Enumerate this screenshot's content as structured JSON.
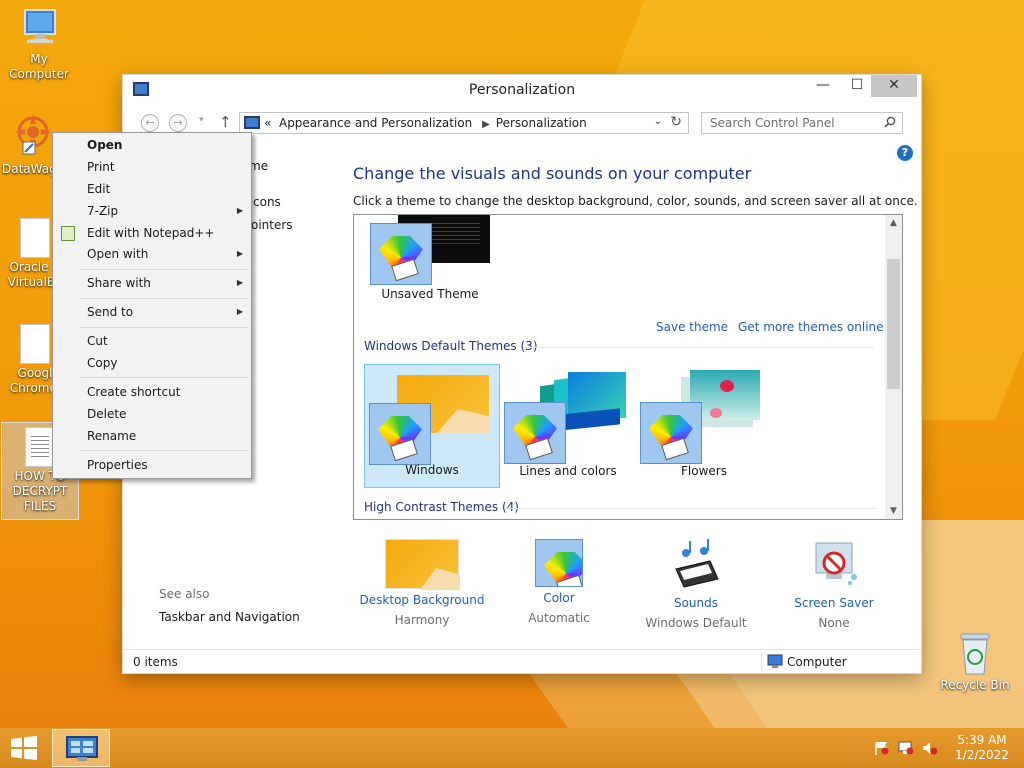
{
  "desktop": {
    "icons": [
      {
        "label": "My Computer"
      },
      {
        "label": "DataWag"
      },
      {
        "label_line1": "Oracle V",
        "label_line2": "VirtualBo"
      },
      {
        "label_line1": "Googl",
        "label_line2": "Chromel"
      },
      {
        "label_line1": "HOW TO",
        "label_line2": "DECRYPT",
        "label_line3": "FILES"
      },
      {
        "label": "Recycle Bin"
      }
    ]
  },
  "window": {
    "title": "Personalization",
    "controls": {
      "minimize": "—",
      "maximize": "☐",
      "close": "✕"
    },
    "address": {
      "prefix": "«",
      "crumbs": [
        "Appearance and Personalization",
        "Personalization"
      ]
    },
    "search": {
      "placeholder": "Search Control Panel"
    },
    "left_pane": {
      "links": [
        "me",
        "cons",
        "ointers"
      ],
      "see_also": "See also",
      "see_also_links": [
        "Taskbar and Navigation"
      ]
    },
    "heading": "Change the visuals and sounds on your computer",
    "subtext": "Click a theme to change the desktop background, color, sounds, and screen saver all at once.",
    "themes": {
      "unsaved_label": "Unsaved Theme",
      "save_link": "Save theme",
      "more_link": "Get more themes online",
      "default_group": "Windows Default Themes (3)",
      "default_items": [
        "Windows",
        "Lines and colors",
        "Flowers"
      ],
      "selected": "Windows",
      "high_contrast_group": "High Contrast Themes (4)"
    },
    "bottom": [
      {
        "label": "Desktop Background",
        "sub": "Harmony"
      },
      {
        "label": "Color",
        "sub": "Automatic"
      },
      {
        "label": "Sounds",
        "sub": "Windows Default"
      },
      {
        "label": "Screen Saver",
        "sub": "None"
      }
    ],
    "status": {
      "items": "0 items",
      "location": "Computer"
    }
  },
  "context_menu": {
    "items": [
      {
        "label": "Open",
        "bold": true
      },
      {
        "label": "Print"
      },
      {
        "label": "Edit"
      },
      {
        "label": "7-Zip",
        "submenu": true
      },
      {
        "label": "Edit with Notepad++",
        "icon": "notepad-plus-plus-icon"
      },
      {
        "label": "Open with",
        "submenu": true
      },
      {
        "label": "Share with",
        "submenu": true
      },
      {
        "label": "Send to",
        "submenu": true
      },
      {
        "label": "Cut"
      },
      {
        "label": "Copy"
      },
      {
        "label": "Create shortcut"
      },
      {
        "label": "Delete"
      },
      {
        "label": "Rename"
      },
      {
        "label": "Properties"
      }
    ]
  },
  "taskbar": {
    "time": "5:39 AM",
    "date": "1/2/2022",
    "tray_icons": [
      "action-center-flag-icon",
      "network-icon",
      "volume-muted-icon"
    ]
  },
  "colors": {
    "accent": "#1e3287",
    "link": "#1f5fb3",
    "selection": "#cde8f7",
    "desktop": "#f29a0a"
  }
}
